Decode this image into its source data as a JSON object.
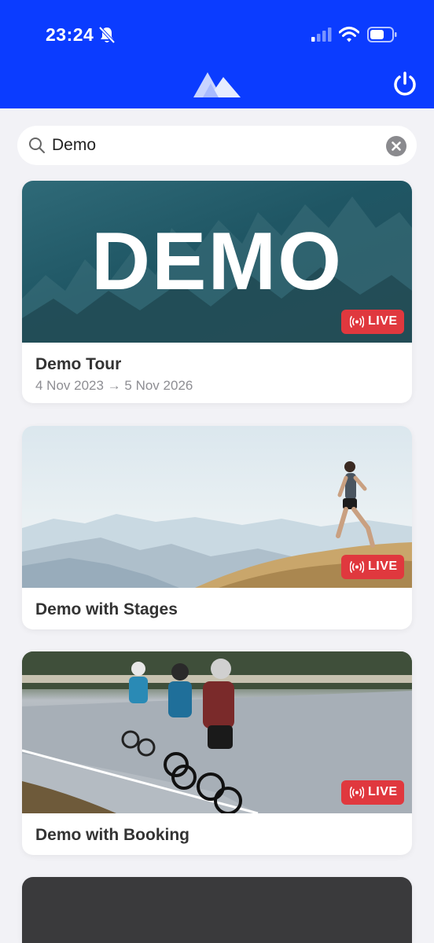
{
  "status_bar": {
    "time": "23:24",
    "icons": [
      "bell-slash-icon",
      "cellular-signal-icon",
      "wifi-icon",
      "battery-icon"
    ]
  },
  "header": {
    "logo": "mountain-logo",
    "power_icon": "power-icon",
    "color": "#0b3cff"
  },
  "search": {
    "value": "Demo",
    "icon": "search-icon",
    "clear_icon": "clear-icon"
  },
  "events": [
    {
      "title": "Demo Tour",
      "dates": "4 Nov 2023 → 5 Nov 2026",
      "badge": "LIVE",
      "image_text": "DEMO"
    },
    {
      "title": "Demo with Stages",
      "badge": "LIVE"
    },
    {
      "title": "Demo with Booking",
      "badge": "LIVE"
    }
  ],
  "colors": {
    "accent": "#0b3cff",
    "live": "#e0383e",
    "background": "#f2f2f6"
  }
}
